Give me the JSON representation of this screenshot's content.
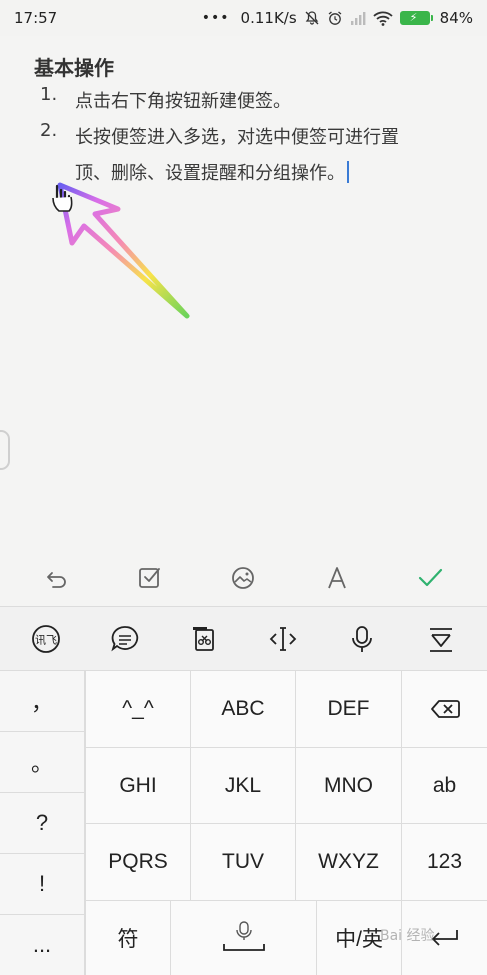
{
  "status_bar": {
    "time": "17:57",
    "dots": "•••",
    "net_speed": "0.11K/s",
    "battery_percent": "84%",
    "icons": [
      "mute-icon",
      "alarm-icon",
      "signal-icon",
      "wifi-icon",
      "battery-charging-icon"
    ]
  },
  "note": {
    "heading": "基本操作",
    "items": [
      {
        "number": "1.",
        "lines": [
          "点击右下角按钮新建便签。"
        ]
      },
      {
        "number": "2.",
        "lines": [
          "长按便签进入多选，对选中便签可进行置",
          "顶、删除、设置提醒和分组操作。"
        ]
      }
    ]
  },
  "editor_toolbar": {
    "buttons": [
      "undo-icon",
      "checklist-icon",
      "image-icon",
      "text-format-icon",
      "confirm-check-icon"
    ],
    "accent_color": "#2fb26f"
  },
  "keyboard": {
    "toolbar": [
      "input-method-logo-icon",
      "emoji-bubble-icon",
      "clipboard-icon",
      "cursor-move-icon",
      "microphone-icon",
      "hide-keyboard-icon"
    ],
    "punctuation": [
      "，",
      "。",
      "?",
      "!",
      "..."
    ],
    "rows": [
      [
        "^_^",
        "ABC",
        "DEF"
      ],
      [
        "GHI",
        "JKL",
        "MNO"
      ],
      [
        "PQRS",
        "TUV",
        "WXYZ"
      ]
    ],
    "right_column": [
      "ab",
      "123"
    ],
    "bottom": {
      "symbol": "符",
      "lang": "中/英"
    }
  },
  "watermark": "Bai 经验"
}
